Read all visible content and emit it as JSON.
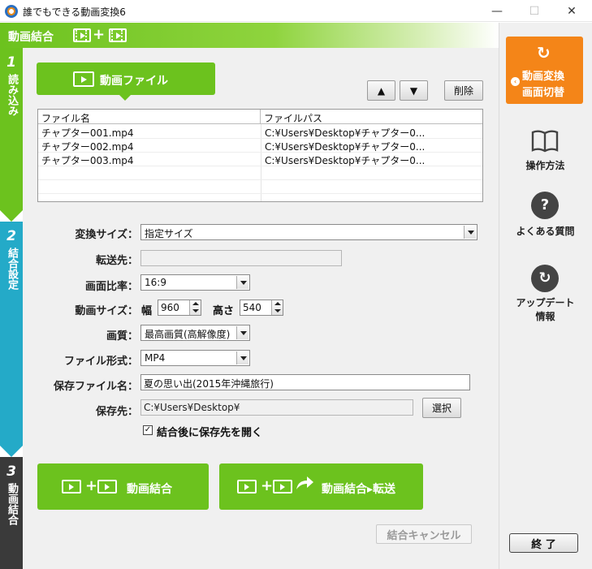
{
  "window": {
    "title": "誰でもできる動画変換6",
    "minimize": "—",
    "maximize": "☐",
    "close": "✕"
  },
  "header": {
    "title": "動画結合",
    "plus": "+"
  },
  "steps": [
    {
      "num": "1",
      "label": "読み込み"
    },
    {
      "num": "2",
      "label": "結合設定"
    },
    {
      "num": "3",
      "label": "動画結合"
    }
  ],
  "file_tab": {
    "label": "動画ファイル"
  },
  "list_buttons": {
    "up": "▲",
    "down": "▼",
    "delete": "削除"
  },
  "file_table": {
    "headers": [
      "ファイル名",
      "ファイルパス"
    ],
    "rows": [
      {
        "name": "チャプター001.mp4",
        "path": "C:¥Users¥Desktop¥チャプター0..."
      },
      {
        "name": "チャプター002.mp4",
        "path": "C:¥Users¥Desktop¥チャプター0..."
      },
      {
        "name": "チャプター003.mp4",
        "path": "C:¥Users¥Desktop¥チャプター0..."
      }
    ]
  },
  "form": {
    "convert_size": {
      "label": "変換サイズ：",
      "value": "指定サイズ"
    },
    "transfer_to": {
      "label": "転送先：",
      "value": ""
    },
    "aspect": {
      "label": "画面比率：",
      "value": "16:9"
    },
    "video_size": {
      "label": "動画サイズ：",
      "width_label": "幅",
      "width": "960",
      "height_label": "高さ",
      "height": "540"
    },
    "quality": {
      "label": "画質：",
      "value": "最高画質(高解像度)"
    },
    "format": {
      "label": "ファイル形式：",
      "value": "MP4"
    },
    "save_name": {
      "label": "保存ファイル名：",
      "value": "夏の思い出(2015年沖縄旅行)"
    },
    "save_to": {
      "label": "保存先：",
      "value": "C:¥Users¥Desktop¥",
      "select_button": "選択"
    },
    "open_after": {
      "label": "結合後に保存先を開く",
      "checked": "✓"
    }
  },
  "actions": {
    "merge": "動画結合",
    "merge_transfer": "動画結合▸転送",
    "cancel": "結合キャンセル"
  },
  "sidebar": {
    "switch": {
      "line1": "動画変換",
      "line2": "画面切替",
      "icon": "↻"
    },
    "help": "操作方法",
    "faq": "よくある質問",
    "faq_icon": "?",
    "update_line1": "アップデート",
    "update_line2": "情報",
    "update_icon": "↻",
    "exit": "終 了"
  },
  "colors": {
    "green": "#6cc21e",
    "blue": "#24aac8",
    "dark": "#3a3a3a",
    "orange": "#f48518"
  }
}
